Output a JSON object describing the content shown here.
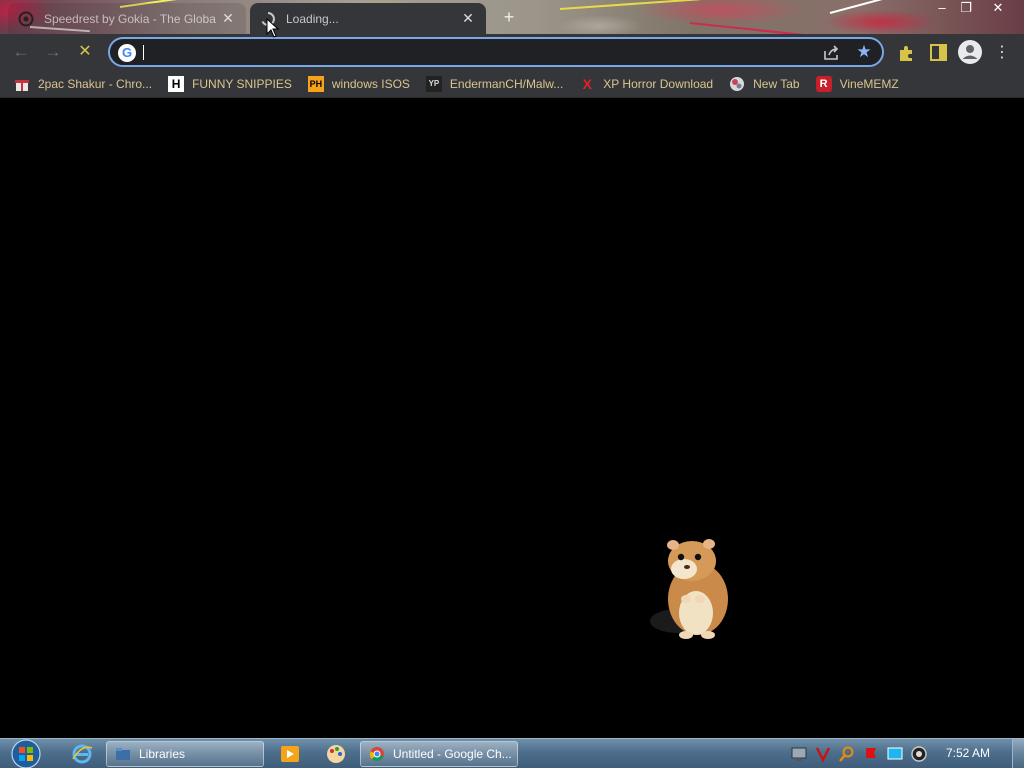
{
  "browser": {
    "tabs": [
      {
        "title": "Speedrest by Gokia - The Globa",
        "state": "inactive"
      },
      {
        "title": "Loading...",
        "state": "active-loading"
      }
    ],
    "omnibox": {
      "value": "",
      "placeholder": ""
    },
    "bookmarks": [
      {
        "label": "2pac Shakur - Chro...",
        "icon": "gift-icon"
      },
      {
        "label": "FUNNY SNIPPIES",
        "icon": "h-letter-icon"
      },
      {
        "label": "windows ISOS",
        "icon": "ph-icon"
      },
      {
        "label": "EndermanCH/Malw...",
        "icon": "yp-icon"
      },
      {
        "label": "XP Horror Download",
        "icon": "red-x-icon"
      },
      {
        "label": "New Tab",
        "icon": "globe-icon"
      },
      {
        "label": "VineMEMZ",
        "icon": "r-icon"
      }
    ],
    "icon_text": {
      "google": "G",
      "ph": "PH",
      "yp": "YP",
      "h": "H",
      "x": "X",
      "r": "R"
    },
    "colors": {
      "toolbar": "#35363a",
      "omnibox_border": "#7aa7e8",
      "bookmark_label": "#d9c58f",
      "content_background": "#000000"
    }
  },
  "taskbar": {
    "tasks": [
      {
        "label": "Libraries",
        "icon": "folder-icon"
      },
      {
        "label": "Untitled - Google Ch...",
        "icon": "chrome-icon"
      }
    ],
    "clock": "7:52 AM"
  }
}
